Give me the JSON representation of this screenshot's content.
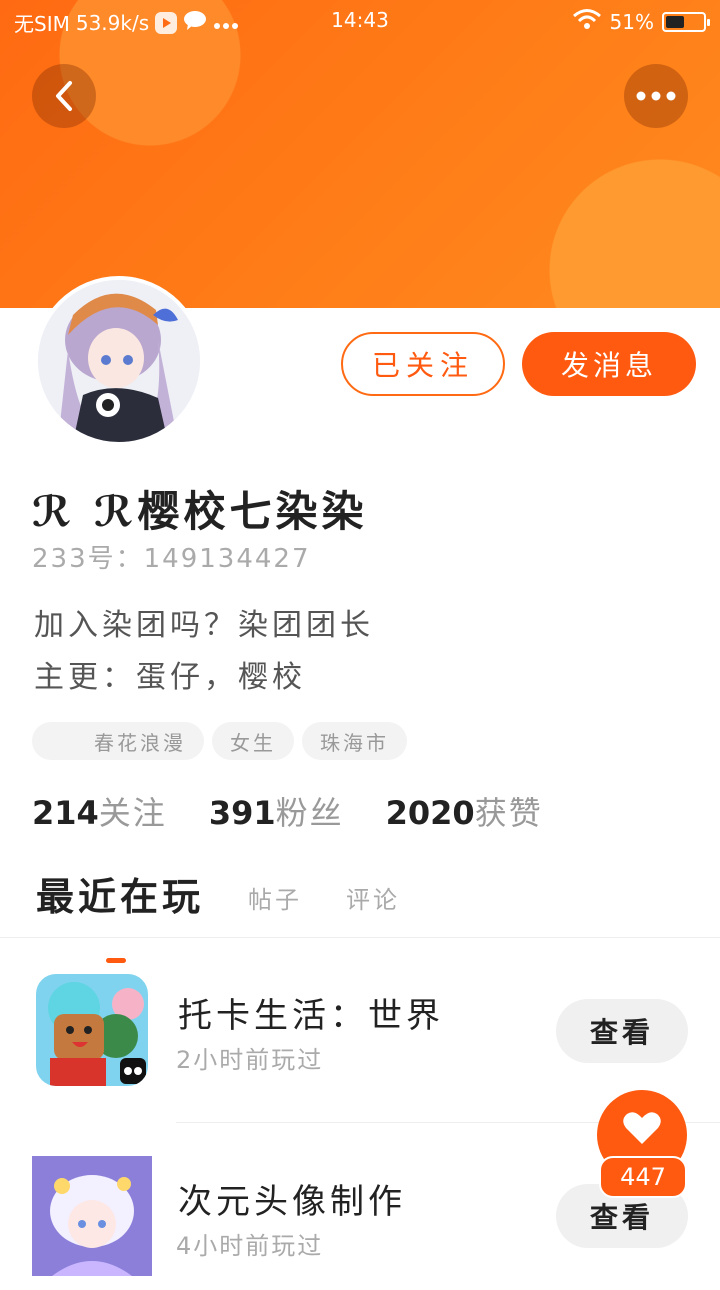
{
  "status_bar": {
    "carrier": "无SIM",
    "speed": "53.9k/s",
    "time": "14:43",
    "battery": "51%",
    "battery_level": 0.51
  },
  "header": {
    "back_icon": "chevron-left-icon",
    "more_icon": "more-horizontal-icon",
    "colors": {
      "primary": "#ff6a12",
      "accent": "#ff5a10"
    }
  },
  "profile": {
    "followed_label": "已关注",
    "message_label": "发消息",
    "nickname": "ℛ ℛ樱校七染染",
    "uid": "233号：149134427",
    "bio_line1": "加入染团吗？染团团长",
    "bio_line2": "主更：蛋仔，樱校",
    "tags": [
      "春花浪漫",
      "女生",
      "珠海市"
    ],
    "stats": [
      {
        "num": "214",
        "label": "关注"
      },
      {
        "num": "391",
        "label": "粉丝"
      },
      {
        "num": "2020",
        "label": "获赞"
      }
    ]
  },
  "tabs": {
    "active": "最近在玩",
    "items": [
      "帖子",
      "评论"
    ]
  },
  "games": [
    {
      "title": "托卡生活：世界",
      "time": "2小时前玩过",
      "button": "查看"
    },
    {
      "title": "次元头像制作",
      "time": "4小时前玩过",
      "button": "查看"
    }
  ],
  "floating": {
    "like_count": "447",
    "icon": "heart-icon"
  }
}
